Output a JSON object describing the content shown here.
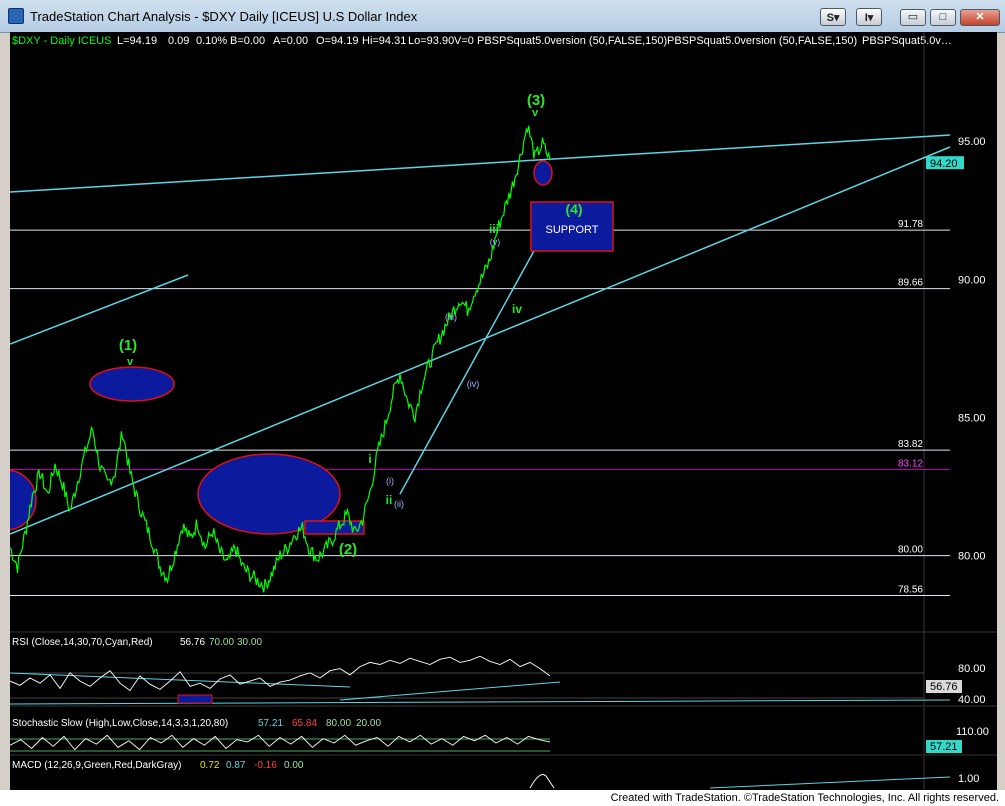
{
  "window": {
    "title": "TradeStation Chart Analysis - $DXY Daily [ICEUS] U.S Dollar Index",
    "btn_s": "S",
    "btn_i": "I",
    "min_glyph": "▭",
    "max_glyph": "□",
    "close_glyph": "✕",
    "dropdown_glyph": "▾"
  },
  "header": {
    "symbol": "$DXY - Daily ICEUS",
    "last": "L=94.19",
    "chg": "0.09",
    "pct": "0.10%",
    "bid": "B=0.00",
    "ask": "A=0.00",
    "open": "O=94.19",
    "high": "Hi=94.31",
    "low": "Lo=93.90",
    "vol": "V=0",
    "ind1": "PBSPSquat5.0version (50,FALSE,150)",
    "ind2": "PBSPSquat5.0version (50,FALSE,150)",
    "ind3": "PBSPSquat5.0v…"
  },
  "colors": {
    "bg": "#000000",
    "price": "#00ff00",
    "cyan": "#5ad6e6",
    "white_line": "#dfe6f0",
    "magenta": "#c400c4",
    "blue_fill": "#0c1a9e",
    "red_outline": "#e01010",
    "label_green": "#2ae62a",
    "label_blue": "#a0b6ff",
    "axis_text": "#ffffff",
    "last_price_box": "#34d8c8",
    "rsi_up": "#ff2020",
    "pale_green": "#9be39b"
  },
  "chart_data": {
    "type": "line",
    "title": "$DXY Daily [ICEUS] U.S Dollar Index",
    "ylim": [
      77.6,
      97.5
    ],
    "y_ticks": [
      80.0,
      85.0,
      90.0,
      95.0
    ],
    "y_tick_labels": [
      "80.00",
      "85.00",
      "90.00",
      "95.00"
    ],
    "last_price": 94.2,
    "last_price_label": "94.20",
    "horizontal_levels": [
      {
        "value": 91.78,
        "label": "91.78",
        "color": "white"
      },
      {
        "value": 89.66,
        "label": "89.66",
        "color": "white"
      },
      {
        "value": 83.82,
        "label": "83.82",
        "color": "white"
      },
      {
        "value": 83.12,
        "label": "83.12",
        "color": "magenta"
      },
      {
        "value": 80.0,
        "label": "80.00",
        "color": "white"
      },
      {
        "value": 78.56,
        "label": "78.56",
        "color": "white"
      }
    ],
    "series": [
      {
        "values": [
          80.3,
          79.6,
          80.8,
          82.2,
          83.0,
          82.2,
          83.3,
          82.6,
          81.6,
          82.7,
          83.7,
          84.6,
          83.2,
          82.6,
          83.0,
          84.5,
          83.0,
          82.0,
          81.2,
          80.5,
          79.6,
          79.2,
          80.1,
          81.1,
          80.6,
          81.2,
          80.3,
          80.9,
          80.1,
          79.7,
          80.3,
          79.6,
          79.3,
          79.1,
          78.9,
          79.4,
          80.0,
          80.3,
          80.8,
          81.0,
          80.2,
          79.9,
          80.2,
          80.6,
          81.1,
          81.5,
          80.8,
          81.3,
          82.3,
          83.7,
          84.7,
          85.8,
          86.6,
          85.6,
          85.1,
          86.3,
          87.0,
          87.7,
          88.3,
          88.8,
          89.3,
          88.9,
          89.6,
          90.1,
          90.7,
          91.8,
          92.6,
          93.4,
          94.4,
          95.6,
          94.4,
          94.9,
          94.3
        ]
      }
    ],
    "wave_labels": [
      {
        "text": "(1)",
        "color": "green"
      },
      {
        "text": "v",
        "color": "green"
      },
      {
        "text": "(2)",
        "color": "green"
      },
      {
        "text": "i",
        "color": "green"
      },
      {
        "text": "ii",
        "color": "green"
      },
      {
        "text": "(i)",
        "color": "blue"
      },
      {
        "text": "(ii)",
        "color": "blue"
      },
      {
        "text": "(iii)",
        "color": "blue"
      },
      {
        "text": "(iv)",
        "color": "blue"
      },
      {
        "text": "(v)",
        "color": "blue"
      },
      {
        "text": "iii",
        "color": "green"
      },
      {
        "text": "iv",
        "color": "green"
      },
      {
        "text": "(3)",
        "color": "green"
      },
      {
        "text": "v",
        "color": "green"
      },
      {
        "text": "(4)",
        "color": "green"
      }
    ],
    "support_box_label": "SUPPORT"
  },
  "rsi": {
    "name": "RSI (Close,14,30,70,Cyan,Red)",
    "value": "56.76",
    "overbought": "70.00",
    "oversold": "30.00",
    "axis_labels": [
      "80.00",
      "40.00"
    ],
    "current_label": "56.76",
    "values": [
      52,
      48,
      55,
      50,
      58,
      45,
      60,
      52,
      47,
      55,
      62,
      50,
      43,
      57,
      49,
      44,
      52,
      61,
      47,
      50,
      45,
      54,
      58,
      49,
      52,
      55,
      47,
      51,
      53,
      57,
      60,
      55,
      62,
      64,
      58,
      66,
      70,
      68,
      72,
      69,
      74,
      71,
      68,
      73,
      75,
      70,
      72,
      76,
      71,
      68,
      73,
      66,
      70,
      64,
      57
    ]
  },
  "stoch": {
    "name": "Stochastic Slow (High,Low,Close,14,3,3,1,20,80)",
    "value1": "57.21",
    "value2": "65.84",
    "ob": "80.00",
    "os": "20.00",
    "axis_label": "110.00",
    "current_label": "57.21",
    "values": [
      40,
      65,
      25,
      75,
      35,
      80,
      20,
      70,
      45,
      85,
      30,
      60,
      20,
      75,
      50,
      85,
      30,
      70,
      40,
      80,
      25,
      65,
      55,
      85,
      35,
      75,
      45,
      80,
      30,
      70,
      50,
      85,
      40,
      60,
      75,
      35,
      80,
      55,
      85,
      45,
      70,
      40,
      80,
      60,
      85,
      50,
      75,
      45,
      80,
      65,
      55
    ]
  },
  "macd": {
    "name": "MACD (12,26,9,Green,Red,DarkGray)",
    "v1": "0.72",
    "v2": "0.87",
    "v3": "-0.16",
    "v4": "0.00",
    "axis_label": "1.00"
  },
  "footer": {
    "credit": "Created with TradeStation. ©TradeStation Technologies, Inc. All rights reserved."
  }
}
